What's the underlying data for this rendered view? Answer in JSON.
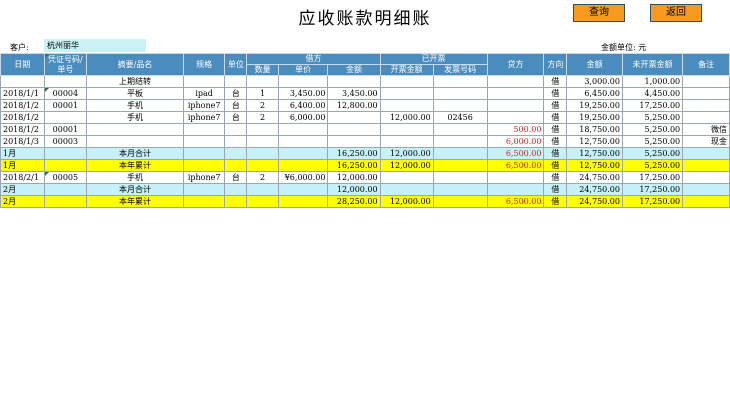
{
  "title": "应收账款明细账",
  "buttons": {
    "query": "查询",
    "back": "返回"
  },
  "customer": {
    "label": "客户:",
    "value": "杭州丽华"
  },
  "unit": "金额单位: 元",
  "headers": {
    "date": "日期",
    "voucher": "凭证号码/单号",
    "summary": "摘要/品名",
    "spec": "规格",
    "unit": "单位",
    "debit": "借方",
    "qty": "数量",
    "price": "单价",
    "amount": "金额",
    "invoiced": "已开票",
    "inv_amount": "开票金额",
    "inv_no": "发票号码",
    "credit": "贷方",
    "direction": "方向",
    "balance": "金额",
    "uninvoiced": "未开票金额",
    "note": "备注"
  },
  "rows": [
    {
      "type": "normal",
      "date": "",
      "voucher": "",
      "summary": "上期结转",
      "spec": "",
      "unit": "",
      "qty": "",
      "price": "",
      "amount": "",
      "inv_amount": "",
      "inv_no": "",
      "credit": "",
      "dir": "借",
      "balance": "3,000.00",
      "uninvoiced": "1,000.00",
      "note": ""
    },
    {
      "type": "normal",
      "date": "2018/1/1",
      "voucher": "00004",
      "summary": "平板",
      "spec": "ipad",
      "unit": "台",
      "qty": "1",
      "price": "3,450.00",
      "amount": "3,450.00",
      "inv_amount": "",
      "inv_no": "",
      "credit": "",
      "dir": "借",
      "balance": "6,450.00",
      "uninvoiced": "4,450.00",
      "note": ""
    },
    {
      "type": "normal",
      "date": "2018/1/2",
      "voucher": "00001",
      "summary": "手机",
      "spec": "iphone7",
      "unit": "台",
      "qty": "2",
      "price": "6,400.00",
      "amount": "12,800.00",
      "inv_amount": "",
      "inv_no": "",
      "credit": "",
      "dir": "借",
      "balance": "19,250.00",
      "uninvoiced": "17,250.00",
      "note": ""
    },
    {
      "type": "normal",
      "date": "2018/1/2",
      "voucher": "",
      "summary": "手机",
      "spec": "iphone7",
      "unit": "台",
      "qty": "2",
      "price": "6,000.00",
      "amount": "",
      "inv_amount": "12,000.00",
      "inv_no": "02456",
      "credit": "",
      "dir": "借",
      "balance": "19,250.00",
      "uninvoiced": "5,250.00",
      "note": ""
    },
    {
      "type": "normal",
      "date": "2018/1/2",
      "voucher": "00001",
      "summary": "",
      "spec": "",
      "unit": "",
      "qty": "",
      "price": "",
      "amount": "",
      "inv_amount": "",
      "inv_no": "",
      "credit": "500.00",
      "dir": "借",
      "balance": "18,750.00",
      "uninvoiced": "5,250.00",
      "note": "微信"
    },
    {
      "type": "normal",
      "date": "2018/1/3",
      "voucher": "00003",
      "summary": "",
      "spec": "",
      "unit": "",
      "qty": "",
      "price": "",
      "amount": "",
      "inv_amount": "",
      "inv_no": "",
      "credit": "6,000.00",
      "dir": "借",
      "balance": "12,750.00",
      "uninvoiced": "5,250.00",
      "note": "现金"
    },
    {
      "type": "monthly",
      "date": "1月",
      "voucher": "",
      "summary": "本月合计",
      "spec": "",
      "unit": "",
      "qty": "",
      "price": "",
      "amount": "16,250.00",
      "inv_amount": "12,000.00",
      "inv_no": "",
      "credit": "6,500.00",
      "dir": "借",
      "balance": "12,750.00",
      "uninvoiced": "5,250.00",
      "note": ""
    },
    {
      "type": "yearly",
      "date": "1月",
      "voucher": "",
      "summary": "本年累计",
      "spec": "",
      "unit": "",
      "qty": "",
      "price": "",
      "amount": "16,250.00",
      "inv_amount": "12,000.00",
      "inv_no": "",
      "credit": "6,500.00",
      "dir": "借",
      "balance": "12,750.00",
      "uninvoiced": "5,250.00",
      "note": ""
    },
    {
      "type": "normal",
      "date": "2018/2/1",
      "voucher": "00005",
      "summary": "手机",
      "spec": "iphone7",
      "unit": "台",
      "qty": "2",
      "price": "¥6,000.00",
      "amount": "12,000.00",
      "inv_amount": "",
      "inv_no": "",
      "credit": "",
      "dir": "借",
      "balance": "24,750.00",
      "uninvoiced": "17,250.00",
      "note": ""
    },
    {
      "type": "monthly",
      "date": "2月",
      "voucher": "",
      "summary": "本月合计",
      "spec": "",
      "unit": "",
      "qty": "",
      "price": "",
      "amount": "12,000.00",
      "inv_amount": "",
      "inv_no": "",
      "credit": "",
      "dir": "借",
      "balance": "24,750.00",
      "uninvoiced": "17,250.00",
      "note": ""
    },
    {
      "type": "yearly",
      "date": "2月",
      "voucher": "",
      "summary": "本年累计",
      "spec": "",
      "unit": "",
      "qty": "",
      "price": "",
      "amount": "28,250.00",
      "inv_amount": "12,000.00",
      "inv_no": "",
      "credit": "6,500.00",
      "dir": "借",
      "balance": "24,750.00",
      "uninvoiced": "17,250.00",
      "note": ""
    }
  ]
}
